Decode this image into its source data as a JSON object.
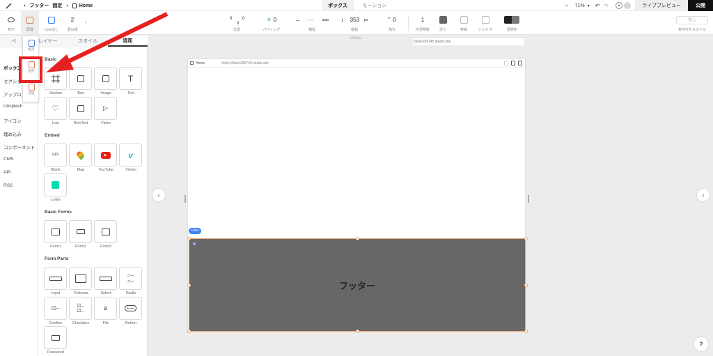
{
  "topbar": {
    "page1_label": "フッター",
    "page1_tag": "固定",
    "page2_label": "Home",
    "tab_box": "ボックス",
    "tab_motion": "モーション",
    "zoom": "71%",
    "live_preview": "ライブプレビュー",
    "publish": "公開"
  },
  "props": {
    "display_label": "表示",
    "position_label": "配置",
    "overflow_label": "はみ出し",
    "stack_value": "2",
    "stack_label": "重ね順",
    "pos_top": "0",
    "pos_left": "0",
    "pos_right": "0",
    "pos_bottom": "0",
    "pos_label": "位置",
    "padding_value": "0",
    "padding_label": "パディング",
    "width_value": "----",
    "width_auto": "auto",
    "width_label": "横幅",
    "height_value": "353",
    "height_unit": "px",
    "height_label": "縦幅",
    "radius_value": "0",
    "radius_label": "角丸",
    "opacity_value": "1",
    "opacity_label": "不透明度",
    "fill_label": "塗り",
    "border_label": "枠線",
    "shadow_label": "シャドウ",
    "blend_label": "透明色",
    "conditional_value": "なし",
    "conditional_label": "条件付きスタイル",
    "fill_color": "#666666"
  },
  "panel": {
    "tabs": [
      "ペ",
      "レイヤー",
      "スタイル",
      "追加"
    ],
    "categories": [
      "ボックス",
      "セクショ",
      "アップロ",
      "Unsplash",
      "アイコン",
      "埋め込み",
      "コンポーネント",
      "CMS",
      "API",
      "RSS"
    ],
    "sections": {
      "basic": "Basic",
      "embed": "Embed",
      "forms": "Basic Forms",
      "parts": "Form Parts"
    },
    "basic_items": [
      "Section",
      "Box",
      "Image",
      "Text",
      "Icon",
      "RichText",
      "Video"
    ],
    "embed_items": [
      "Blank",
      "Map",
      "YouTube",
      "Vimeo",
      "Lottie"
    ],
    "form_items": [
      "Form1",
      "Form2",
      "Form3"
    ],
    "part_items": [
      "Input",
      "Textarea",
      "Select",
      "Radio",
      "Confirm",
      "Checkbox",
      "File",
      "Button",
      "Password"
    ],
    "button_mini": "Button"
  },
  "popup": {
    "items": [
      "相対",
      "固定",
      "追従"
    ]
  },
  "canvas": {
    "width_label": "1280px",
    "url_top": "black289745.studio.site",
    "page_title": "Home",
    "page_url": "https://black289745.studio.site",
    "div_tag": "<div>",
    "footer_text": "フッター",
    "help": "?"
  }
}
